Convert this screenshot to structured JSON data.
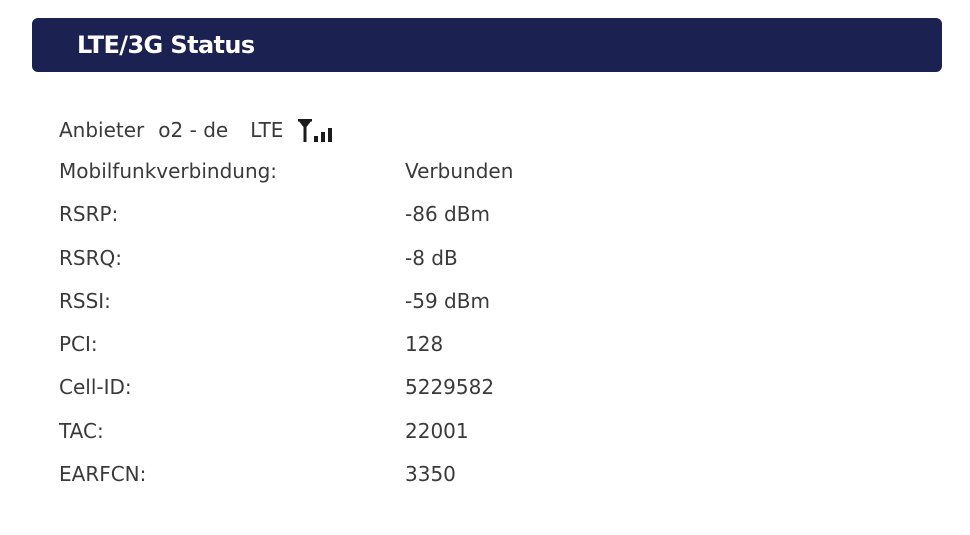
{
  "header": {
    "title": "LTE/3G Status"
  },
  "provider": {
    "label": "Anbieter",
    "name": "o2 - de",
    "technology": "LTE",
    "signal_icon": "signal-strength-icon"
  },
  "rows": [
    {
      "label": "Mobilfunkverbindung:",
      "value": "Verbunden"
    },
    {
      "label": "RSRP:",
      "value": "-86 dBm"
    },
    {
      "label": "RSRQ:",
      "value": "-8 dB"
    },
    {
      "label": "RSSI:",
      "value": "-59 dBm"
    },
    {
      "label": "PCI:",
      "value": "128"
    },
    {
      "label": "Cell-ID:",
      "value": "5229582"
    },
    {
      "label": "TAC:",
      "value": "22001"
    },
    {
      "label": "EARFCN:",
      "value": "3350"
    }
  ],
  "colors": {
    "header_bg": "#1b2150",
    "header_text": "#ffffff",
    "body_text": "#3a3a3a"
  }
}
